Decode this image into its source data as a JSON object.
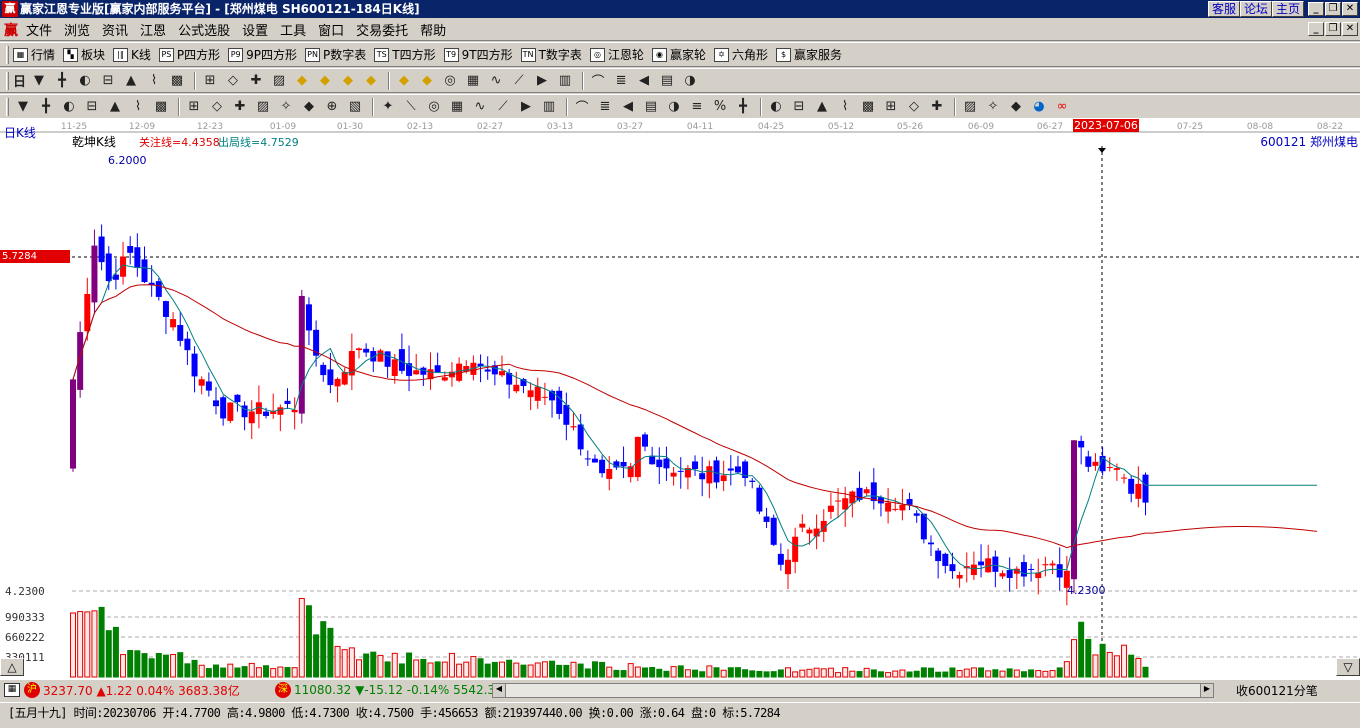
{
  "title": "赢家江恩专业版[赢家内部服务平台] - [郑州煤电   SH600121-184日K线]",
  "logo": "赢",
  "title_buttons": [
    "客服",
    "论坛",
    "主页"
  ],
  "menu": [
    "文件",
    "浏览",
    "资讯",
    "江恩",
    "公式选股",
    "设置",
    "工具",
    "窗口",
    "交易委托",
    "帮助"
  ],
  "toolbar1": [
    {
      "icon": "▦",
      "name": "quotes",
      "label": "行情"
    },
    {
      "icon": "▚",
      "name": "sector",
      "label": "板块"
    },
    {
      "icon": "|‖",
      "name": "kline",
      "label": "K线"
    },
    {
      "icon": "PS",
      "name": "p-square",
      "label": "P四方形"
    },
    {
      "icon": "P9",
      "name": "9p-square",
      "label": "9P四方形"
    },
    {
      "icon": "PN",
      "name": "p-number-table",
      "label": "P数字表"
    },
    {
      "icon": "TS",
      "name": "t-square",
      "label": "T四方形"
    },
    {
      "icon": "T9",
      "name": "9t-square",
      "label": "9T四方形"
    },
    {
      "icon": "TN",
      "name": "t-number-table",
      "label": "T数字表"
    },
    {
      "icon": "◎",
      "name": "gann-wheel",
      "label": "江恩轮"
    },
    {
      "icon": "◉",
      "name": "winner-wheel",
      "label": "赢家轮"
    },
    {
      "icon": "✡",
      "name": "hexagon",
      "label": "六角形"
    },
    {
      "icon": "$",
      "name": "winner-service",
      "label": "赢家服务"
    }
  ],
  "toolbar2_period": "日",
  "toolbar2_icons": [
    "period-dropdown",
    "indicator",
    "draw-tool",
    "dropdown",
    "cursor-icon",
    "chart-type",
    "flag",
    "first",
    "last",
    "left",
    "right",
    "diamond-1",
    "diamond-2",
    "diamond-3",
    "diamond-4",
    "diamond-5",
    "diamond-6",
    "hand",
    "crosshair",
    "line-1",
    "pattern",
    "gear",
    "calendar",
    "calculator",
    "window",
    "save",
    "export",
    "truck"
  ],
  "toolbar3_icons": [
    "pen",
    "bars-1",
    "bars-2",
    "bars-3",
    "bars-4",
    "bars-5",
    "bars-6",
    "circle",
    "bars-7",
    "bars-8",
    "wave",
    "circle-cross",
    "star",
    "box-star",
    "angle",
    "fork",
    "volume-bars",
    "bars-9",
    "grid-lines",
    "fan-1",
    "fan-2",
    "fan-3",
    "fan-4",
    "fan-5",
    "grid-1",
    "grid-2",
    "lines",
    "list",
    "percent-line",
    "percent",
    "fib-1",
    "fib-2",
    "arrows",
    "fib-3",
    "fib-4",
    "fib-5",
    "fib-6",
    "fib-7",
    "fib-8",
    "fib-9",
    "fib-10",
    "fib-11",
    "globe",
    "infinity"
  ],
  "chart": {
    "period_label": "日K线",
    "indicator_name": "乾坤K线",
    "focus_line": "关注线=4.4358",
    "exit_line": "出局线=4.7529",
    "stock_label": "600121  郑州煤电",
    "cursor_date": "2023-07-06",
    "cursor_price": "5.7284",
    "high_label": "6.2000",
    "low_label": "4.2300",
    "date_ticks": [
      "11-25",
      "12-09",
      "12-23",
      "01-09",
      "01-30",
      "02-13",
      "02-27",
      "03-13",
      "03-27",
      "04-11",
      "04-25",
      "05-12",
      "05-26",
      "06-09",
      "06-27",
      "07-25",
      "08-08",
      "08-22"
    ],
    "volume_ticks": [
      "4.2300",
      "990333",
      "660222",
      "330111"
    ],
    "closes_keypoints": [
      [
        0,
        5.18
      ],
      [
        3,
        5.8
      ],
      [
        5,
        5.62
      ],
      [
        8,
        5.74
      ],
      [
        11,
        5.58
      ],
      [
        14,
        5.45
      ],
      [
        17,
        5.22
      ],
      [
        21,
        5.04
      ],
      [
        27,
        5.04
      ],
      [
        31,
        5.06
      ],
      [
        32,
        5.58
      ],
      [
        33,
        5.36
      ],
      [
        36,
        5.15
      ],
      [
        40,
        5.33
      ],
      [
        46,
        5.22
      ],
      [
        51,
        5.2
      ],
      [
        56,
        5.29
      ],
      [
        58,
        5.2
      ],
      [
        63,
        5.15
      ],
      [
        67,
        5.09
      ],
      [
        70,
        4.95
      ],
      [
        74,
        4.73
      ],
      [
        78,
        4.77
      ],
      [
        79,
        4.91
      ],
      [
        82,
        4.8
      ],
      [
        88,
        4.75
      ],
      [
        94,
        4.77
      ],
      [
        96,
        4.59
      ],
      [
        99,
        4.35
      ],
      [
        102,
        4.5
      ],
      [
        107,
        4.62
      ],
      [
        110,
        4.66
      ],
      [
        114,
        4.66
      ],
      [
        117,
        4.59
      ],
      [
        120,
        4.44
      ],
      [
        123,
        4.32
      ],
      [
        126,
        4.37
      ],
      [
        132,
        4.32
      ],
      [
        137,
        4.36
      ],
      [
        139,
        4.3
      ],
      [
        140,
        4.91
      ],
      [
        142,
        4.8
      ],
      [
        144,
        4.75
      ],
      [
        146,
        4.8
      ],
      [
        148,
        4.7
      ],
      [
        150,
        4.66
      ]
    ],
    "candle_count": 151,
    "volume_keypoints": [
      [
        0,
        1300000
      ],
      [
        3,
        1150000
      ],
      [
        4,
        900000
      ],
      [
        5,
        700000
      ],
      [
        8,
        500000
      ],
      [
        14,
        350000
      ],
      [
        20,
        200000
      ],
      [
        31,
        150000
      ],
      [
        32,
        1300000
      ],
      [
        34,
        800000
      ],
      [
        40,
        400000
      ],
      [
        60,
        260000
      ],
      [
        80,
        160000
      ],
      [
        100,
        120000
      ],
      [
        138,
        120000
      ],
      [
        139,
        350000
      ],
      [
        140,
        1000000
      ],
      [
        142,
        600000
      ],
      [
        146,
        500000
      ],
      [
        150,
        150000
      ]
    ],
    "colors": {
      "up": "#ff0000",
      "down": "#0000ff",
      "big": "#800080",
      "ma_short": "#008080",
      "ma_long": "#c00000",
      "vol_down": "#008000"
    }
  },
  "status": {
    "sh_badge": "沪",
    "sh_text": "3237.70 ▲1.22 0.04% 3683.38亿",
    "sz_badge": "深",
    "sz_text": "11080.32 ▼-15.12 -0.14% 5542.3",
    "right_label": "收600121分笔"
  },
  "info": "[五月十九] 时间:20230706 开:4.7700 高:4.9800 低:4.7300 收:4.7500 手:456653 额:219397440.00 换:0.00 涨:0.64 盘:0 标:5.7284"
}
